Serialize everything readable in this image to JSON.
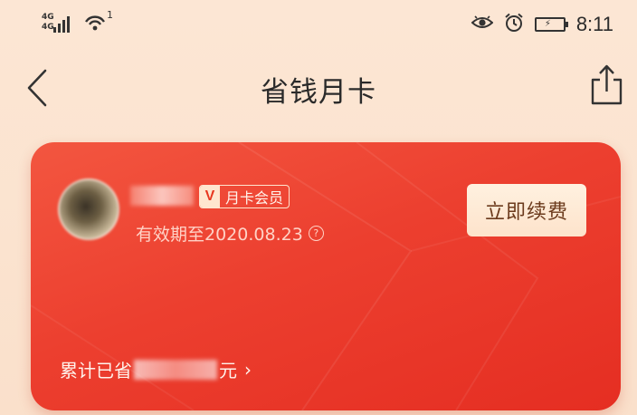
{
  "status_bar": {
    "network": "4G",
    "network_sub": "4G",
    "wifi_badge": "1",
    "time": "8:11",
    "icons": [
      "signal-icon",
      "wifi-icon",
      "eye-icon",
      "alarm-icon",
      "battery-charging-icon"
    ]
  },
  "nav": {
    "title": "省钱月卡",
    "back_icon": "chevron-left-icon",
    "share_icon": "share-icon"
  },
  "card": {
    "member_badge_letter": "V",
    "member_badge_label": "月卡会员",
    "expiry_text": "有效期至2020.08.23",
    "help_icon": "?",
    "renew_label": "立即续费",
    "saved_prefix": "累计已省",
    "saved_suffix": "元",
    "saved_chevron": "›",
    "colors": {
      "card_red": "#ec3f2f",
      "button_cream": "#fde3cb",
      "page_bg": "#fbe3cf"
    }
  }
}
